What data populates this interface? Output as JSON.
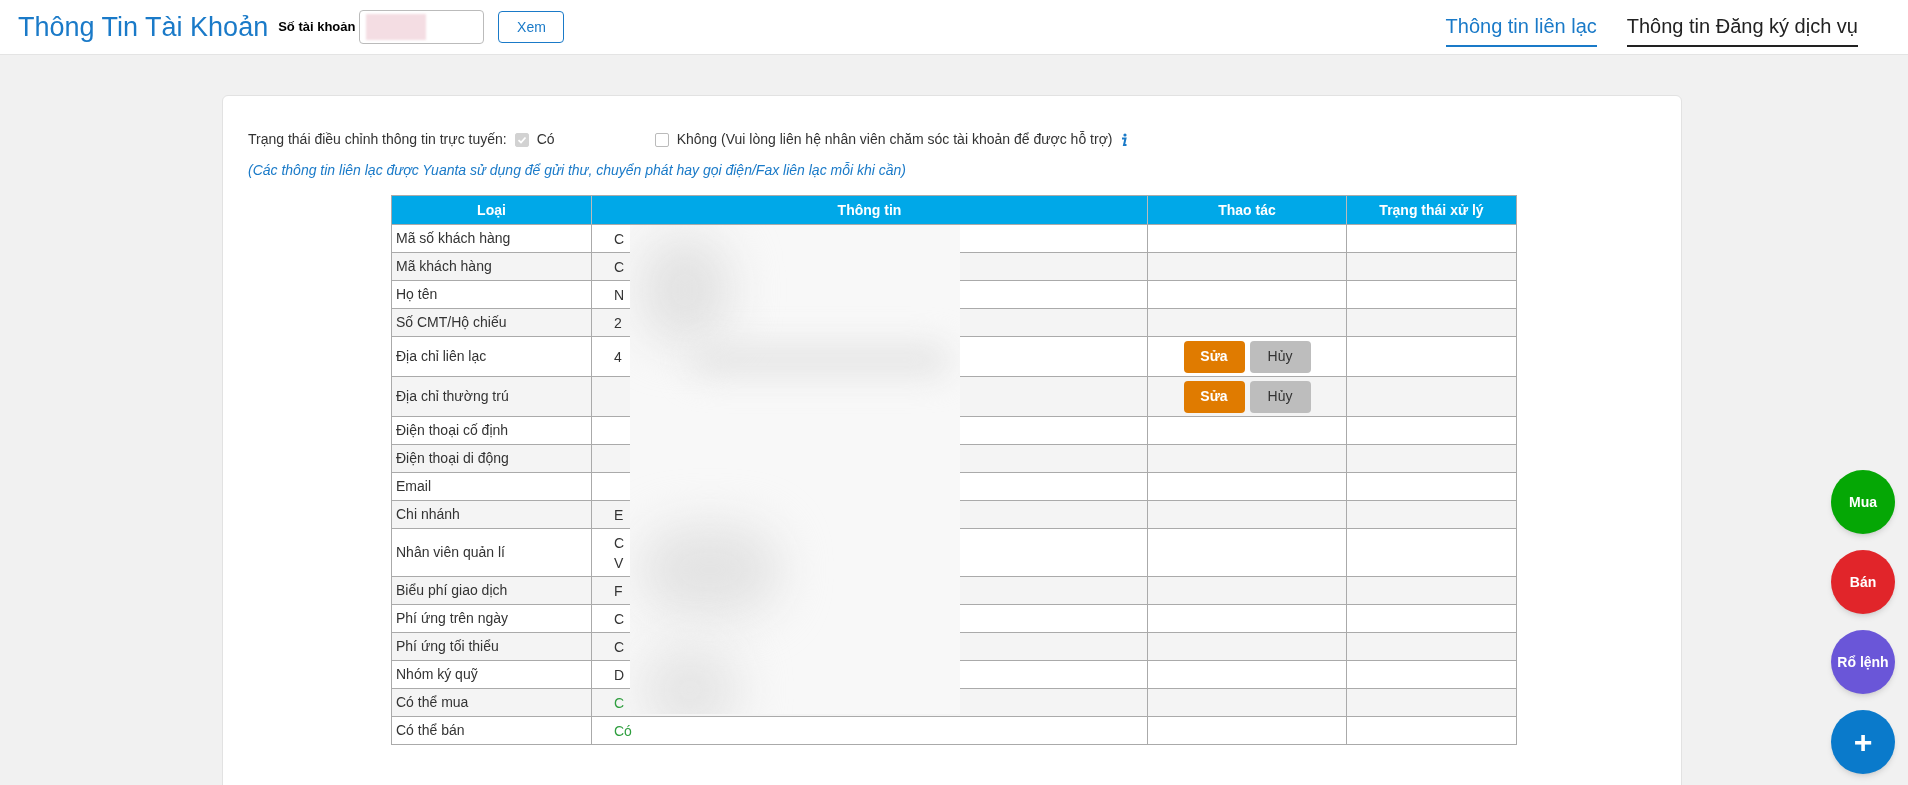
{
  "header": {
    "title": "Thông Tin Tài Khoản",
    "account_label": "Số tài khoản",
    "view_button": "Xem"
  },
  "tabs": [
    {
      "label": "Thông tin liên lạc",
      "selected": true
    },
    {
      "label": "Thông tin Đăng ký dịch vụ",
      "selected": false
    }
  ],
  "online_edit": {
    "label": "Trạng thái điều chỉnh thông tin trực tuyến:",
    "options": [
      {
        "label": "Có",
        "checked": true,
        "disabled": true
      },
      {
        "label": "Không (Vui lòng liên hệ nhân viên chăm sóc tài khoản để được hỗ trợ)",
        "checked": false,
        "disabled": false
      }
    ]
  },
  "note": "(Các thông tin liên lạc được Yuanta sử dụng để gửi thư, chuyển phát hay gọi điện/Fax liên lạc mỗi khi cần)",
  "table": {
    "columns": [
      "Loại",
      "Thông tin",
      "Thao tác",
      "Trạng thái xử lý"
    ],
    "rows": [
      {
        "label": "Mã số khách hàng",
        "info": [
          "C"
        ]
      },
      {
        "label": "Mã khách hàng",
        "info": [
          "C"
        ]
      },
      {
        "label": "Họ tên",
        "info": [
          "N"
        ]
      },
      {
        "label": "Số CMT/Hộ chiếu",
        "info": [
          "2"
        ]
      },
      {
        "label": "Địa chỉ liên lạc",
        "info": [
          "4"
        ],
        "actions": [
          {
            "label": "Sửa",
            "kind": "edit"
          },
          {
            "label": "Hủy",
            "kind": "cancel"
          }
        ]
      },
      {
        "label": "Địa chỉ thường trú",
        "actions": [
          {
            "label": "Sửa",
            "kind": "edit"
          },
          {
            "label": "Hủy",
            "kind": "cancel"
          }
        ]
      },
      {
        "label": "Điện thoại cố định"
      },
      {
        "label": "Điện thoại di động"
      },
      {
        "label": "Email"
      },
      {
        "label": "Chi nhánh",
        "info": [
          "E"
        ]
      },
      {
        "label": "Nhân viên quản lí",
        "info": [
          "C",
          "V"
        ]
      },
      {
        "label": "Biểu phí giao dịch",
        "info": [
          "F"
        ]
      },
      {
        "label": "Phí ứng trên ngày",
        "info": [
          "C"
        ]
      },
      {
        "label": "Phí ứng tối thiểu",
        "info": [
          "C"
        ]
      },
      {
        "label": "Nhóm ký quỹ",
        "info": [
          "D"
        ]
      },
      {
        "label": "Có thể mua",
        "info": [
          "C"
        ],
        "color": "#2e9e3e"
      },
      {
        "label": "Có thể bán",
        "info": [
          "Có"
        ],
        "color": "#2e9e3e"
      }
    ]
  },
  "floating_buttons": [
    {
      "label": "Mua",
      "color": "#05a705"
    },
    {
      "label": "Bán",
      "color": "#e1252a"
    },
    {
      "label": "Rổ lệnh",
      "color": "#6a56d8"
    },
    {
      "label": "+",
      "color": "#0a7acb"
    }
  ]
}
